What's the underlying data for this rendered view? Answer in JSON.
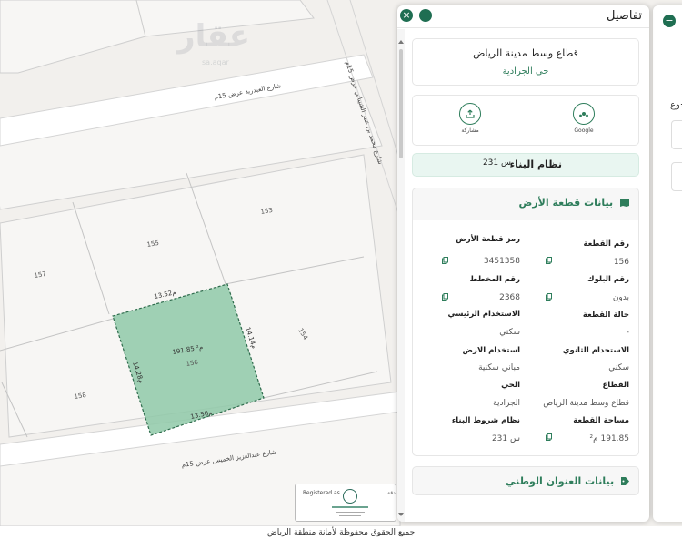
{
  "map": {
    "watermark": "عقار",
    "watermark_sub": "sa.aqar",
    "roads": {
      "top_road": "شارع العبدرية عرض 15م",
      "diag_road": "شارع محمد بن عمر الشيباني عرض 15م",
      "bottom_road": "شارع عبدالعزيز الخميس عرض 15م"
    },
    "parcels": {
      "p153": "153",
      "p155": "155",
      "p157": "157",
      "p154": "154",
      "p158": "158",
      "p156": "156"
    },
    "selected": {
      "area": "191.85 م²",
      "top_dim": "13.52م",
      "right_dim": "14.14م",
      "left_dim": "14.28م",
      "bottom_dim": "13.50م"
    },
    "footer": "جميع الحقوق محفوظة لأمانة منطقة الرياض",
    "stamp": {
      "registered": "Registered as",
      "side": "دقة"
    },
    "colors": {
      "selected_fill": "#8fc9a8",
      "selected_stroke": "#2e6b4c"
    }
  },
  "panel": {
    "title": "تفاصيل",
    "close_icon": "close-icon",
    "minimize_icon": "minus-icon",
    "summary": {
      "title": "قطاع وسط مدينة الرياض",
      "district": "حي الجرادية"
    },
    "actions": {
      "google_label": "Google",
      "share_label": "مشاركة"
    },
    "building": {
      "label": "نظام البناء",
      "value": "س 231"
    },
    "land": {
      "header": "بيانات قطعة الأرض",
      "fields": {
        "parcel_no_label": "رقم القطعة",
        "parcel_no": "156",
        "parcel_code_label": "رمز قطعة الأرض",
        "parcel_code": "3451358",
        "block_label": "رقم البلوك",
        "block": "بدون",
        "plan_label": "رقم المخطط",
        "plan": "2368",
        "status_label": "حالة القطعة",
        "status": "-",
        "main_use_label": "الاستخدام الرئيسي",
        "main_use": "سكني",
        "secondary_use_label": "الاستخدام الثانوي",
        "secondary_use": "سكني",
        "land_use_label": "استخدام الارض",
        "land_use": "مباني سكنية",
        "sector_label": "القطاع",
        "sector": "قطاع وسط مدينة الرياض",
        "district_label": "الحي",
        "district": "الجرادية",
        "area_label": "مساحة القطعة",
        "area": "191.85 م²",
        "conditions_label": "نظام شروط البناء",
        "conditions": "س 231"
      }
    },
    "address": {
      "header": "بيانات العنوان الوطني"
    },
    "accent": "#2e7d5b"
  },
  "side": {
    "text": "جوع"
  }
}
